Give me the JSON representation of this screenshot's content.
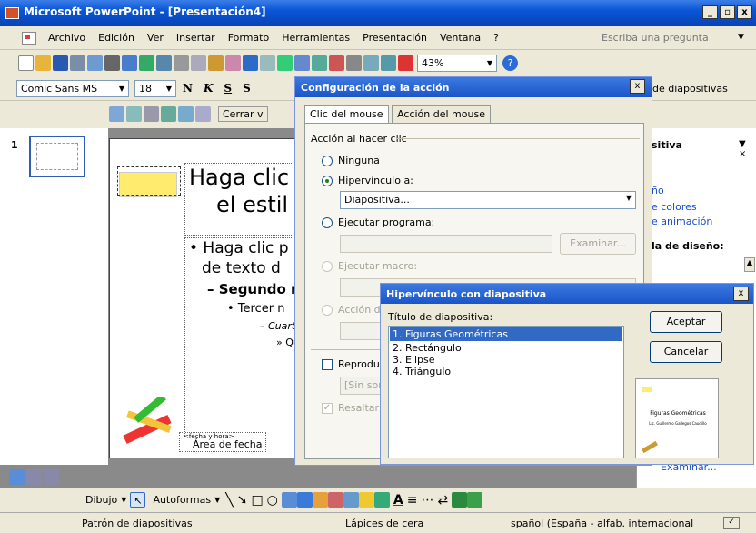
{
  "window": {
    "title": "Microsoft PowerPoint - [Presentación4]"
  },
  "menu": {
    "items": [
      "Archivo",
      "Edición",
      "Ver",
      "Insertar",
      "Formato",
      "Herramientas",
      "Presentación",
      "Ventana",
      "?"
    ],
    "ask": "Escriba una pregunta"
  },
  "toolbar": {
    "zoom": "43%"
  },
  "format": {
    "font": "Comic Sans MS",
    "size": "18",
    "bold": "N",
    "italic": "K",
    "underline": "S",
    "shadow": "S",
    "design_label": "de diapositivas"
  },
  "master": {
    "close": "Cerrar v"
  },
  "thumb": {
    "number": "1"
  },
  "slide": {
    "title_line1": "Haga clic",
    "title_line2": "el estil",
    "b1a": "• Haga clic p",
    "b1b": "de texto d",
    "b2": "– Segundo n",
    "b3": "• Tercer n",
    "b4": "– Cuarto",
    "b5": "» Qu",
    "date_small": "<fecha y hora>",
    "date_area": "Área de fecha"
  },
  "taskpane": {
    "title": "sitiva",
    "item1": "ño",
    "item2": "e colores",
    "item3": "e animación",
    "item4": "la de diseño:",
    "examinar": "Examinar..."
  },
  "action_dialog": {
    "title": "Configuración de la acción",
    "tab_click": "Clic del mouse",
    "tab_mouseover": "Acción del mouse",
    "group": "Acción al hacer clic",
    "opt_none": "Ninguna",
    "opt_hyper": "Hipervínculo a:",
    "hyper_value": "Diapositiva...",
    "opt_run": "Ejecutar programa:",
    "browse": "Examinar...",
    "opt_macro": "Ejecutar macro:",
    "opt_object": "Acción de",
    "play_sound": "Reprodu",
    "sound_value": "[Sin son",
    "highlight": "Resaltar"
  },
  "hyper_dialog": {
    "title": "Hipervínculo con diapositiva",
    "label": "Título de diapositiva:",
    "slides": [
      "1. Figuras Geométricas",
      "2. Rectángulo",
      "3. Elipse",
      "4. Triángulo"
    ],
    "ok": "Aceptar",
    "cancel": "Cancelar",
    "preview_title": "Figuras Geométricas",
    "preview_sub": "Lic. Guillermo Gallegos Caudillo"
  },
  "drawing": {
    "draw": "Dibujo",
    "autoshapes": "Autoformas"
  },
  "status": {
    "view": "Patrón de diapositivas",
    "design": "Lápices de cera",
    "language": "spañol (España - alfab. internacional"
  }
}
